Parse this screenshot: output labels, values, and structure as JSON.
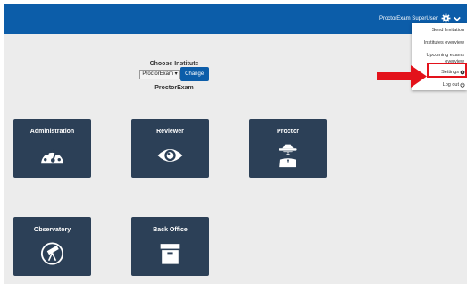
{
  "header": {
    "user_label": "ProctorExam SuperUser",
    "gear_icon": "gear-icon",
    "chevron_icon": "chevron-down-icon",
    "bar_color": "#0c5da9"
  },
  "institute": {
    "title": "Choose Institute",
    "selected": "ProctorExam ▾",
    "change_label": "Change",
    "current_name": "ProctorExam"
  },
  "tiles": [
    {
      "label": "Administration",
      "icon": "dashboard-gauge-icon"
    },
    {
      "label": "Reviewer",
      "icon": "eye-icon"
    },
    {
      "label": "Proctor",
      "icon": "spy-agent-icon"
    },
    {
      "label": "Observatory",
      "icon": "telescope-icon"
    },
    {
      "label": "Back Office",
      "icon": "archive-box-icon"
    }
  ],
  "dropdown": {
    "items": [
      {
        "label": "Send Invitation"
      },
      {
        "label": "Institutes overview"
      },
      {
        "label": "Upcoming exams overview"
      },
      {
        "label": "Settings",
        "icon": "gear-icon"
      },
      {
        "label": "Log out",
        "icon": "power-icon"
      }
    ]
  },
  "annotation": {
    "color": "#e3121b",
    "arrow_icon": "red-arrow-right"
  }
}
